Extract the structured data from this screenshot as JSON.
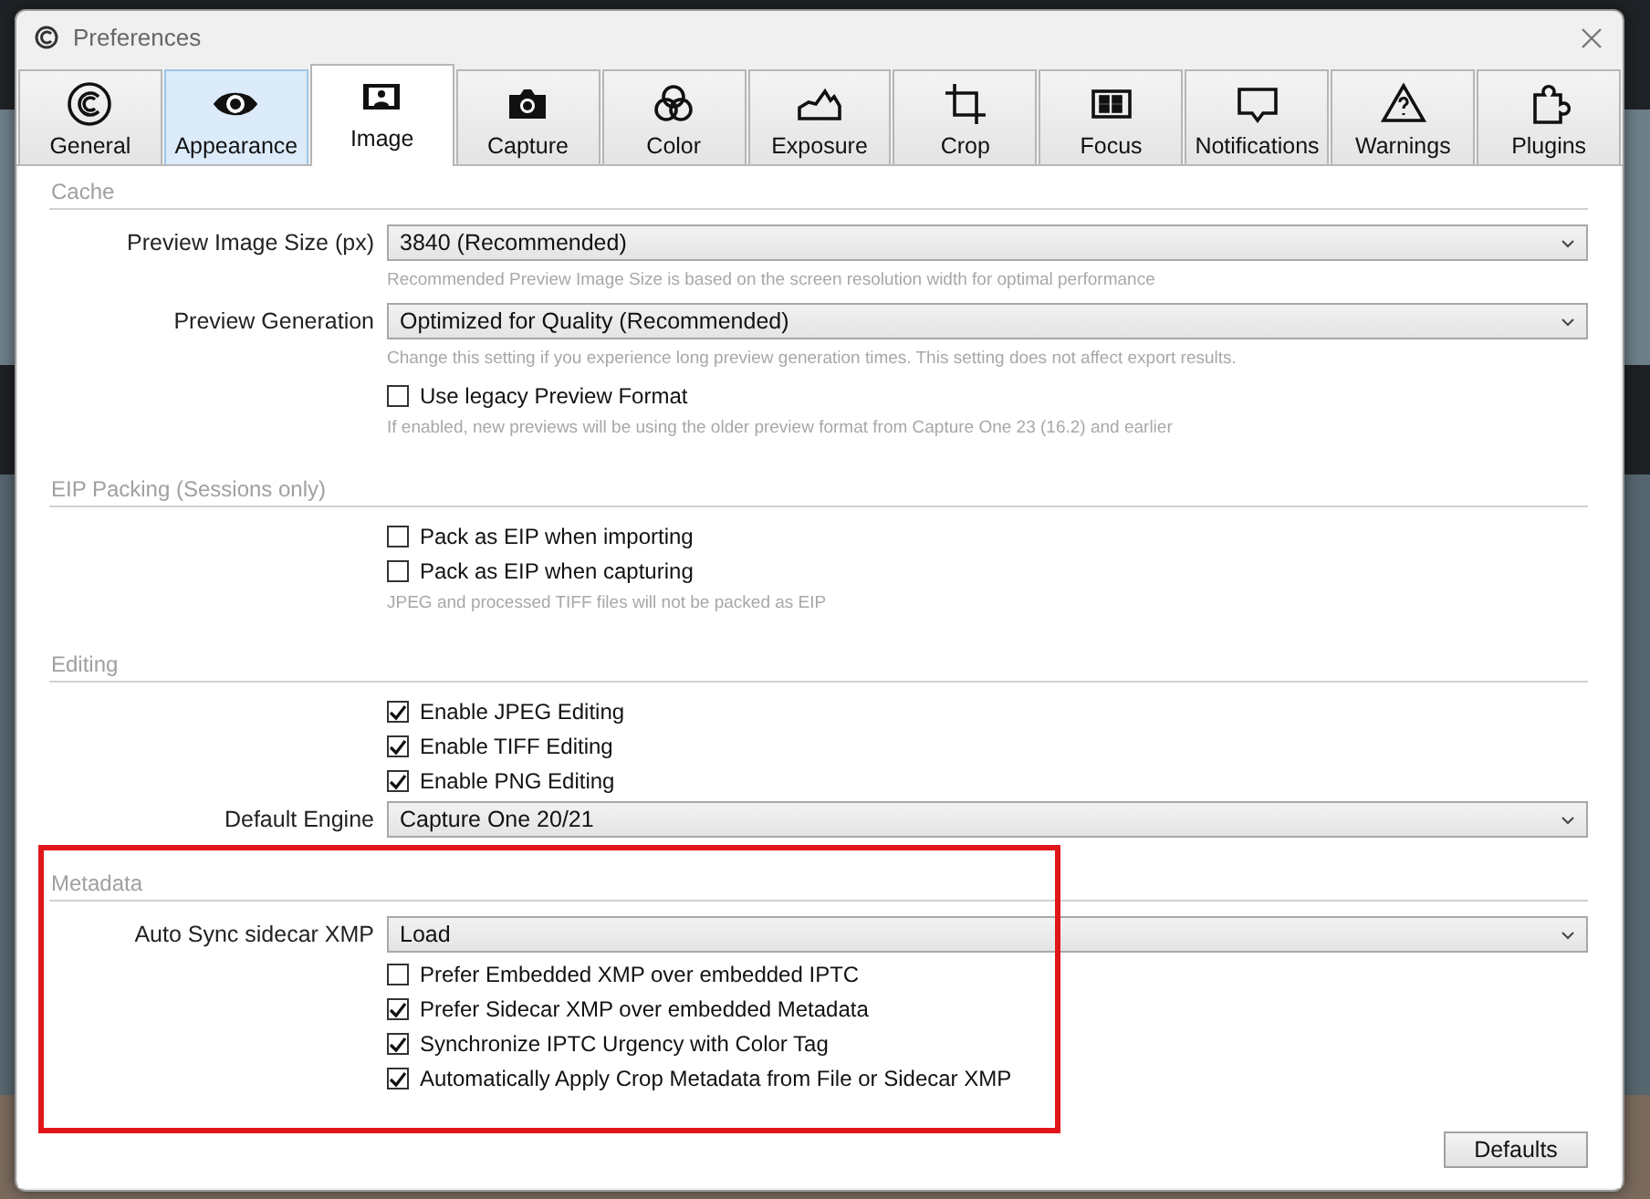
{
  "window": {
    "title": "Preferences"
  },
  "tabs": [
    {
      "label": "General",
      "selected": false,
      "hovered": false
    },
    {
      "label": "Appearance",
      "selected": false,
      "hovered": true
    },
    {
      "label": "Image",
      "selected": true,
      "hovered": false
    },
    {
      "label": "Capture",
      "selected": false,
      "hovered": false
    },
    {
      "label": "Color",
      "selected": false,
      "hovered": false
    },
    {
      "label": "Exposure",
      "selected": false,
      "hovered": false
    },
    {
      "label": "Crop",
      "selected": false,
      "hovered": false
    },
    {
      "label": "Focus",
      "selected": false,
      "hovered": false
    },
    {
      "label": "Notifications",
      "selected": false,
      "hovered": false
    },
    {
      "label": "Warnings",
      "selected": false,
      "hovered": false
    },
    {
      "label": "Plugins",
      "selected": false,
      "hovered": false
    }
  ],
  "sections": [
    {
      "title": "Cache",
      "highlighted": false,
      "rows": [
        {
          "kind": "select",
          "label": "Preview Image Size (px)",
          "value": "3840 (Recommended)"
        },
        {
          "kind": "hint",
          "text": "Recommended Preview Image Size is based on the screen resolution width for optimal performance"
        },
        {
          "kind": "select",
          "label": "Preview Generation",
          "value": "Optimized for Quality (Recommended)"
        },
        {
          "kind": "hint",
          "text": "Change this setting if you experience long preview generation times. This setting does not affect export results."
        },
        {
          "kind": "checkbox",
          "label": "Use legacy Preview Format",
          "checked": false
        },
        {
          "kind": "hint",
          "text": "If enabled, new previews will be using the older preview format from Capture One 23 (16.2) and earlier"
        }
      ]
    },
    {
      "title": "EIP Packing (Sessions only)",
      "highlighted": false,
      "rows": [
        {
          "kind": "checkbox",
          "label": "Pack as EIP when importing",
          "checked": false
        },
        {
          "kind": "checkbox",
          "label": "Pack as EIP when capturing",
          "checked": false
        },
        {
          "kind": "hint",
          "text": "JPEG and processed TIFF files will not be packed as EIP"
        }
      ]
    },
    {
      "title": "Editing",
      "highlighted": false,
      "rows": [
        {
          "kind": "checkbox",
          "label": "Enable JPEG Editing",
          "checked": true
        },
        {
          "kind": "checkbox",
          "label": "Enable TIFF Editing",
          "checked": true
        },
        {
          "kind": "checkbox",
          "label": "Enable PNG Editing",
          "checked": true
        },
        {
          "kind": "select",
          "label": "Default Engine",
          "value": "Capture One 20/21"
        }
      ]
    },
    {
      "title": "Metadata",
      "highlighted": true,
      "rows": [
        {
          "kind": "select",
          "label": "Auto Sync sidecar XMP",
          "value": "Load"
        },
        {
          "kind": "checkbox",
          "label": "Prefer Embedded XMP over embedded IPTC",
          "checked": false
        },
        {
          "kind": "checkbox",
          "label": "Prefer Sidecar XMP over embedded Metadata",
          "checked": true
        },
        {
          "kind": "checkbox",
          "label": "Synchronize IPTC Urgency with Color Tag",
          "checked": true
        },
        {
          "kind": "checkbox",
          "label": "Automatically Apply Crop Metadata from File or Sidecar XMP",
          "checked": true
        }
      ]
    }
  ],
  "buttons": [
    "Defaults"
  ]
}
